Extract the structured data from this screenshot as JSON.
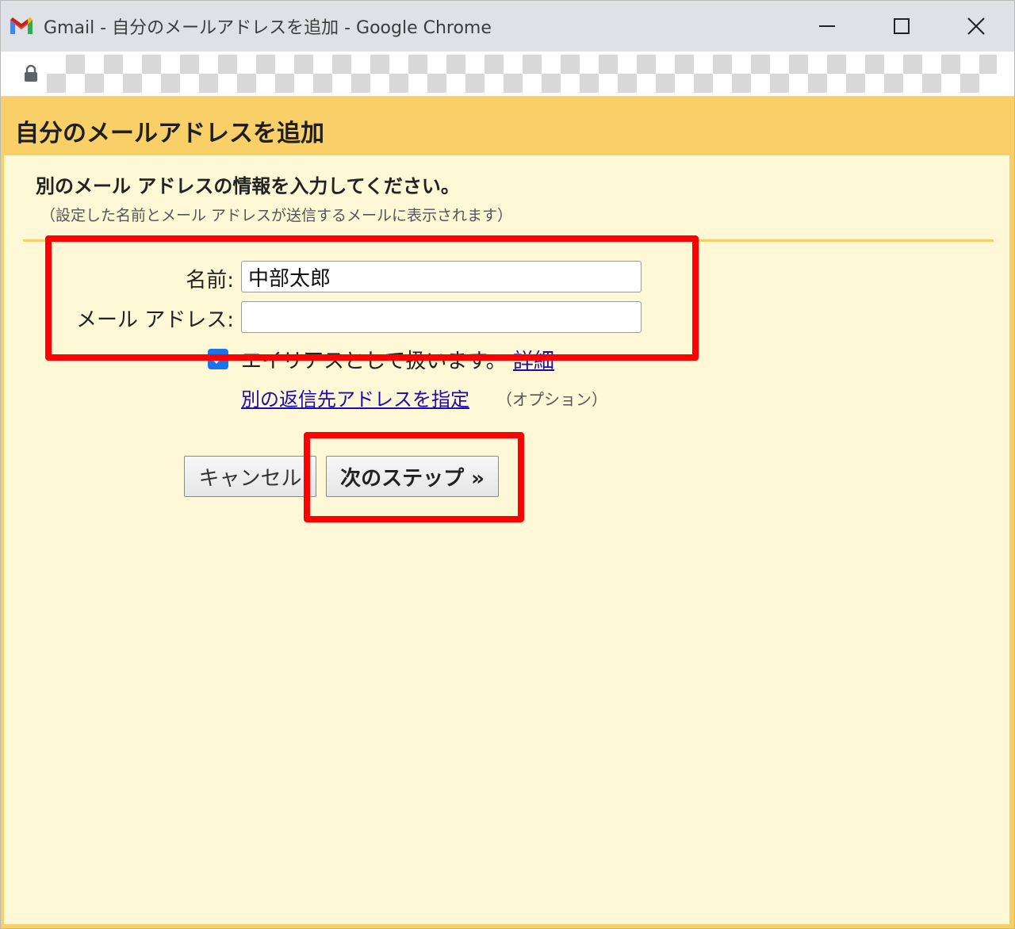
{
  "window": {
    "title": "Gmail - 自分のメールアドレスを追加 - Google Chrome",
    "logo_icon": "gmail-logo-icon",
    "controls": [
      "minimize-icon",
      "maximize-icon",
      "close-icon"
    ]
  },
  "address_bar": {
    "lock_icon": "lock-icon",
    "url_redacted": true
  },
  "dialog": {
    "title": "自分のメールアドレスを追加",
    "instruction": "別のメール アドレスの情報を入力してください。",
    "note": "（設定した名前とメール アドレスが送信するメールに表示されます）",
    "fields": {
      "name_label": "名前:",
      "name_value": "中部太郎",
      "email_label": "メール アドレス:",
      "email_value": ""
    },
    "alias": {
      "checked": true,
      "label": "エイリアスとして扱います。",
      "detail_link": "詳細"
    },
    "reply_to": {
      "link": "別の返信先アドレスを指定",
      "option_note": "（オプション）"
    },
    "buttons": {
      "cancel": "キャンセル",
      "next": "次のステップ »"
    }
  },
  "colors": {
    "header_bg": "#f9d068",
    "body_bg": "#fff8d6",
    "link": "#1a0dab",
    "highlight": "#ff0000",
    "checkbox": "#1a73e8"
  }
}
